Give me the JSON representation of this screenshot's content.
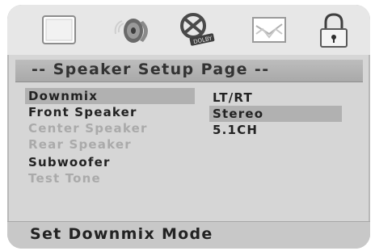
{
  "icons": [
    {
      "name": "general-setup-icon"
    },
    {
      "name": "speaker-icon"
    },
    {
      "name": "dolby-digital-icon"
    },
    {
      "name": "preference-icon"
    },
    {
      "name": "password-lock-icon"
    }
  ],
  "title": "-- Speaker Setup Page --",
  "left_menu": [
    {
      "label": "Downmix",
      "state": "selected"
    },
    {
      "label": "Front Speaker",
      "state": "enabled"
    },
    {
      "label": "Center Speaker",
      "state": "disabled"
    },
    {
      "label": "Rear Speaker",
      "state": "disabled"
    },
    {
      "label": "Subwoofer",
      "state": "enabled"
    },
    {
      "label": "Test Tone",
      "state": "disabled"
    }
  ],
  "right_options": [
    {
      "label": "LT/RT",
      "state": "normal"
    },
    {
      "label": "Stereo",
      "state": "selected"
    },
    {
      "label": "5.1CH",
      "state": "normal"
    }
  ],
  "status": "Set Downmix Mode"
}
